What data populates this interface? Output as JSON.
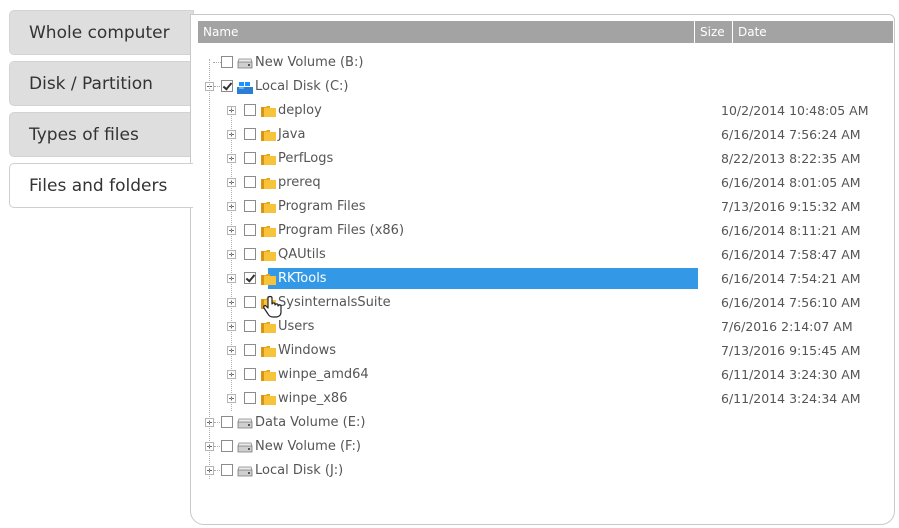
{
  "tabs": [
    {
      "label": "Whole computer"
    },
    {
      "label": "Disk / Partition"
    },
    {
      "label": "Types of files"
    },
    {
      "label": "Files and folders"
    }
  ],
  "table": {
    "headers": {
      "name": "Name",
      "size": "Size",
      "date": "Date"
    }
  },
  "tree": [
    {
      "label": "New Volume (B:)",
      "date": "",
      "checked": false
    },
    {
      "label": "Local Disk (C:)",
      "date": "",
      "checked": true
    },
    {
      "label": "deploy",
      "date": "10/2/2014 10:48:05 AM",
      "checked": false
    },
    {
      "label": "Java",
      "date": "6/16/2014 7:56:24 AM",
      "checked": false
    },
    {
      "label": "PerfLogs",
      "date": "8/22/2013 8:22:35 AM",
      "checked": false
    },
    {
      "label": "prereq",
      "date": "6/16/2014 8:01:05 AM",
      "checked": false
    },
    {
      "label": "Program Files",
      "date": "7/13/2016 9:15:32 AM",
      "checked": false
    },
    {
      "label": "Program Files (x86)",
      "date": "6/16/2014 8:11:21 AM",
      "checked": false
    },
    {
      "label": "QAUtils",
      "date": "6/16/2014 7:58:47 AM",
      "checked": false
    },
    {
      "label": "RKTools",
      "date": "6/16/2014 7:54:21 AM",
      "checked": true
    },
    {
      "label": "SysinternalsSuite",
      "date": "6/16/2014 7:56:10 AM",
      "checked": false
    },
    {
      "label": "Users",
      "date": "7/6/2016 2:14:07 AM",
      "checked": false
    },
    {
      "label": "Windows",
      "date": "7/13/2016 9:15:45 AM",
      "checked": false
    },
    {
      "label": "winpe_amd64",
      "date": "6/11/2014 3:24:30 AM",
      "checked": false
    },
    {
      "label": "winpe_x86",
      "date": "6/11/2014 3:24:34 AM",
      "checked": false
    },
    {
      "label": "Data Volume (E:)",
      "date": "",
      "checked": false
    },
    {
      "label": "New Volume (F:)",
      "date": "",
      "checked": false
    },
    {
      "label": "Local Disk (J:)",
      "date": "",
      "checked": false
    }
  ],
  "colors": {
    "selection": "#3399e6",
    "header": "#a3a3a3",
    "folder": "#f2b625"
  },
  "icons": {
    "folder": "folder-icon",
    "drive": "drive-icon",
    "cursor": "hand-pointer-icon"
  }
}
